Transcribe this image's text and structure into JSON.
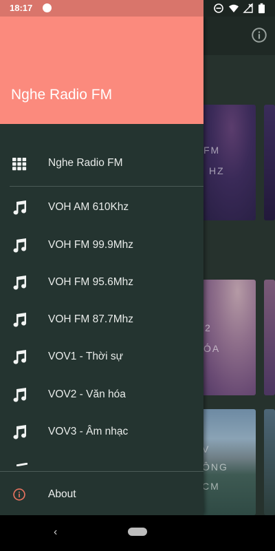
{
  "status_bar": {
    "time": "18:17",
    "icons": [
      "do-not-disturb-icon",
      "wifi-icon",
      "no-signal-icon",
      "battery-icon"
    ]
  },
  "app": {
    "info_icon": "info-icon",
    "cards": [
      {
        "lines": [
          "FM",
          "HZ"
        ]
      },
      {
        "lines": [
          "2",
          "ÓA"
        ]
      },
      {
        "lines": [
          "V",
          "ÔNG",
          "CM"
        ]
      }
    ]
  },
  "drawer": {
    "header_color": "#fb8a7d",
    "title": "Nghe Radio FM",
    "home_item": {
      "icon": "grid-icon",
      "label": "Nghe Radio FM"
    },
    "stations": [
      {
        "icon": "music-note-icon",
        "label": "VOH AM 610Khz"
      },
      {
        "icon": "music-note-icon",
        "label": "VOH FM 99.9Mhz"
      },
      {
        "icon": "music-note-icon",
        "label": "VOH FM 95.6Mhz"
      },
      {
        "icon": "music-note-icon",
        "label": "VOH FM 87.7Mhz"
      },
      {
        "icon": "music-note-icon",
        "label": "VOV1 - Thời sự"
      },
      {
        "icon": "music-note-icon",
        "label": "VOV2 - Văn hóa"
      },
      {
        "icon": "music-note-icon",
        "label": "VOV3 - Âm nhạc"
      }
    ],
    "about_item": {
      "icon": "info-icon",
      "label": "About",
      "icon_color": "#e8735f"
    }
  },
  "nav_bar": {
    "back_icon": "back-icon",
    "home_pill": "home-pill"
  }
}
